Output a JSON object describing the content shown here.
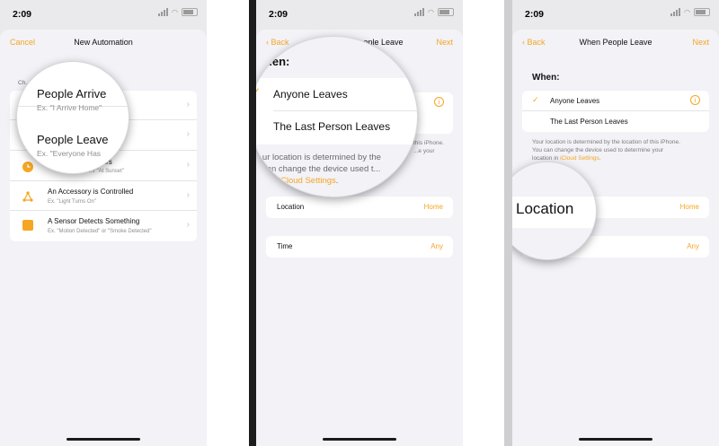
{
  "panels": [
    {
      "status_time": "2:09",
      "nav": {
        "left": "Cancel",
        "title": "New Automation",
        "right": ""
      },
      "subtitle": "Ch... ...tomation to occur.",
      "items": [
        {
          "title": "People Arrive",
          "sub": "Ex. \"I Arrive Home\""
        },
        {
          "title": "People Leave",
          "sub": "Ex. \"Everyone Has..."
        },
        {
          "title": "...ccurs",
          "sub": "...r \"At Sunset\""
        },
        {
          "title": "An Accessory is Controlled",
          "sub": "Ex. \"Light Turns On\""
        },
        {
          "title": "A Sensor Detects Something",
          "sub": "Ex. \"Motion Detected\" or \"Smoke Detected\""
        }
      ],
      "magnifier": {
        "line1": "People Arrive",
        "line1_sub": "Ex. \"I Arrive Home\"",
        "line2": "People Leave",
        "line2_sub": "Ex. \"Everyone Has"
      }
    },
    {
      "status_time": "2:09",
      "nav": {
        "left": "Back",
        "title": "...ople Leave",
        "right": "Next"
      },
      "location": {
        "label": "Location",
        "value": "Home"
      },
      "time": {
        "label": "Time",
        "value": "Any"
      },
      "footnote_tail": [
        "this iPhone.",
        "...e your"
      ],
      "magnifier": {
        "heading": "...en:",
        "opt1": "Anyone Leaves",
        "opt2": "The Last Person Leaves",
        "note_line1": "...ur location is determined by the",
        "note_line2": "...can change the device used t...",
        "note_line3_pre": "...p in ",
        "note_link": "iCloud Settings",
        "note_line3_post": "."
      }
    },
    {
      "status_time": "2:09",
      "nav": {
        "left": "Back",
        "title": "When People Leave",
        "right": "Next"
      },
      "heading": "When:",
      "options": [
        "Anyone Leaves",
        "The Last Person Leaves"
      ],
      "footnote": [
        "Your location is determined by the location of this iPhone.",
        "You can change the device used to determine your",
        "location in "
      ],
      "footnote_link": "iCloud Settings",
      "footnote_end": ".",
      "location_value": "Home",
      "time_value": "Any",
      "magnifier": {
        "label": "Location"
      }
    }
  ],
  "icons": {
    "back": "‹",
    "chevron": "›",
    "check": "✓",
    "info": "i"
  },
  "colors": {
    "accent": "#f5a623",
    "background": "#f2f2f7",
    "card": "#ffffff"
  }
}
